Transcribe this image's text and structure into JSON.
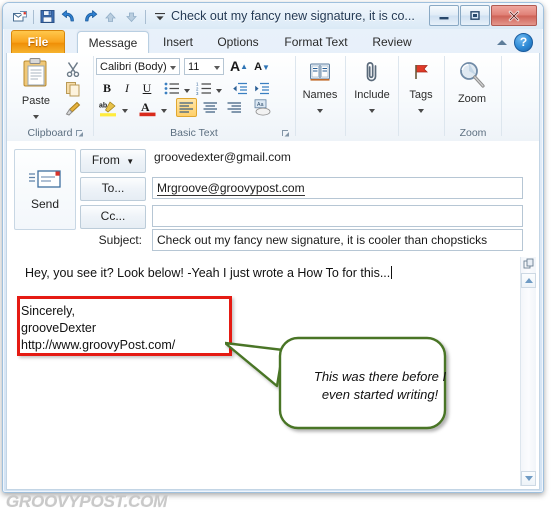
{
  "window": {
    "title": "Check out my fancy new signature, it is co...",
    "quick_access": [
      {
        "name": "mail-icon",
        "glyph": "✉"
      },
      {
        "name": "save-icon",
        "glyph": "💾"
      },
      {
        "name": "undo-icon",
        "glyph": "↶"
      },
      {
        "name": "redo-icon",
        "glyph": "↻"
      },
      {
        "name": "previous-item-icon",
        "glyph": "▲"
      },
      {
        "name": "next-item-icon",
        "glyph": "▼"
      },
      {
        "name": "customize-qat-icon",
        "glyph": "▾"
      }
    ],
    "controls": {
      "minimize": "—",
      "maximize": "□",
      "close": "✕"
    }
  },
  "tabs": [
    {
      "label": "File",
      "active": false,
      "kind": "file"
    },
    {
      "label": "Message",
      "active": true,
      "kind": "normal"
    },
    {
      "label": "Insert",
      "active": false,
      "kind": "normal"
    },
    {
      "label": "Options",
      "active": false,
      "kind": "normal"
    },
    {
      "label": "Format Text",
      "active": false,
      "kind": "normal"
    },
    {
      "label": "Review",
      "active": false,
      "kind": "normal"
    }
  ],
  "help": {
    "collapse_ribbon": "collapse-ribbon-icon",
    "help_label": "?"
  },
  "ribbon": {
    "clipboard": {
      "group_label": "Clipboard",
      "paste_label": "Paste",
      "cut_label": "Cut",
      "copy_label": "Copy",
      "format_painter_label": "Format Painter",
      "launcher": "⬌"
    },
    "basic_text": {
      "group_label": "Basic Text",
      "font_name": "Calibri (Body)",
      "font_size": "11",
      "grow_font": "A",
      "shrink_font": "A",
      "bold": "B",
      "italic": "I",
      "underline": "U",
      "bullets": "bullet-list-icon",
      "numbering": "numbered-list-icon",
      "decrease_indent": "decrease-indent-icon",
      "increase_indent": "increase-indent-icon",
      "highlight": "ab",
      "font_color": "A",
      "align_left": "align-left-icon",
      "align_center": "align-center-icon",
      "align_right": "align-right-icon",
      "clear_formatting": "clear-formatting-icon",
      "launcher": "⬌"
    },
    "names": {
      "label": "Names",
      "icon": "address-book-icon"
    },
    "include": {
      "label": "Include",
      "icon": "paperclip-icon"
    },
    "tags": {
      "label": "Tags",
      "icon": "flag-icon"
    },
    "zoom": {
      "label": "Zoom",
      "group_label": "Zoom",
      "icon": "magnifier-icon"
    }
  },
  "compose": {
    "send_label": "Send",
    "send_icon": "envelope-send-icon",
    "from_label": "From",
    "from_value": "groovedexter@gmail.com",
    "to_label": "To...",
    "to_value": "Mrgroove@groovypost.com",
    "cc_label": "Cc...",
    "cc_value": "",
    "subject_label": "Subject:",
    "subject_value": "Check out my fancy new signature, it is cooler than chopsticks"
  },
  "body": {
    "message_text": "Hey, you see it?  Look below!  -Yeah I just wrote a How To for this...",
    "signature_lines": [
      "Sincerely,",
      "grooveDexter",
      "http://www.groovyPost.com/"
    ],
    "attachment_icon": "attachment-options-icon"
  },
  "annotation": {
    "callout_text": "This was there before I even started writing!",
    "highlight_color": "#e51b13",
    "callout_color": "#4a7527"
  },
  "watermark": "GROOVYPOST.COM"
}
